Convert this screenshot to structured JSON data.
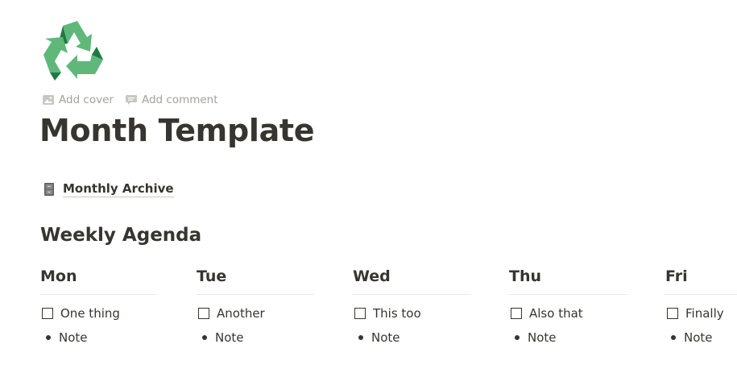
{
  "page": {
    "icon": "recycle-icon",
    "actions": [
      {
        "label": "Add cover",
        "icon": "image-icon"
      },
      {
        "label": "Add comment",
        "icon": "comment-icon"
      }
    ],
    "title": "Month Template",
    "link": {
      "label": "Monthly Archive",
      "icon": "file-cabinet-icon"
    }
  },
  "agenda": {
    "heading": "Weekly Agenda",
    "days": [
      {
        "name": "Mon",
        "todo": "One thing",
        "note": "Note"
      },
      {
        "name": "Tue",
        "todo": "Another",
        "note": "Note"
      },
      {
        "name": "Wed",
        "todo": "This too",
        "note": "Note"
      },
      {
        "name": "Thu",
        "todo": "Also that",
        "note": "Note"
      },
      {
        "name": "Fri",
        "todo": "Finally",
        "note": "Note"
      }
    ]
  },
  "colors": {
    "text": "#37352f",
    "muted": "#a3a19d",
    "recycle_light": "#5fb87a",
    "recycle_dark": "#1f7a42"
  }
}
